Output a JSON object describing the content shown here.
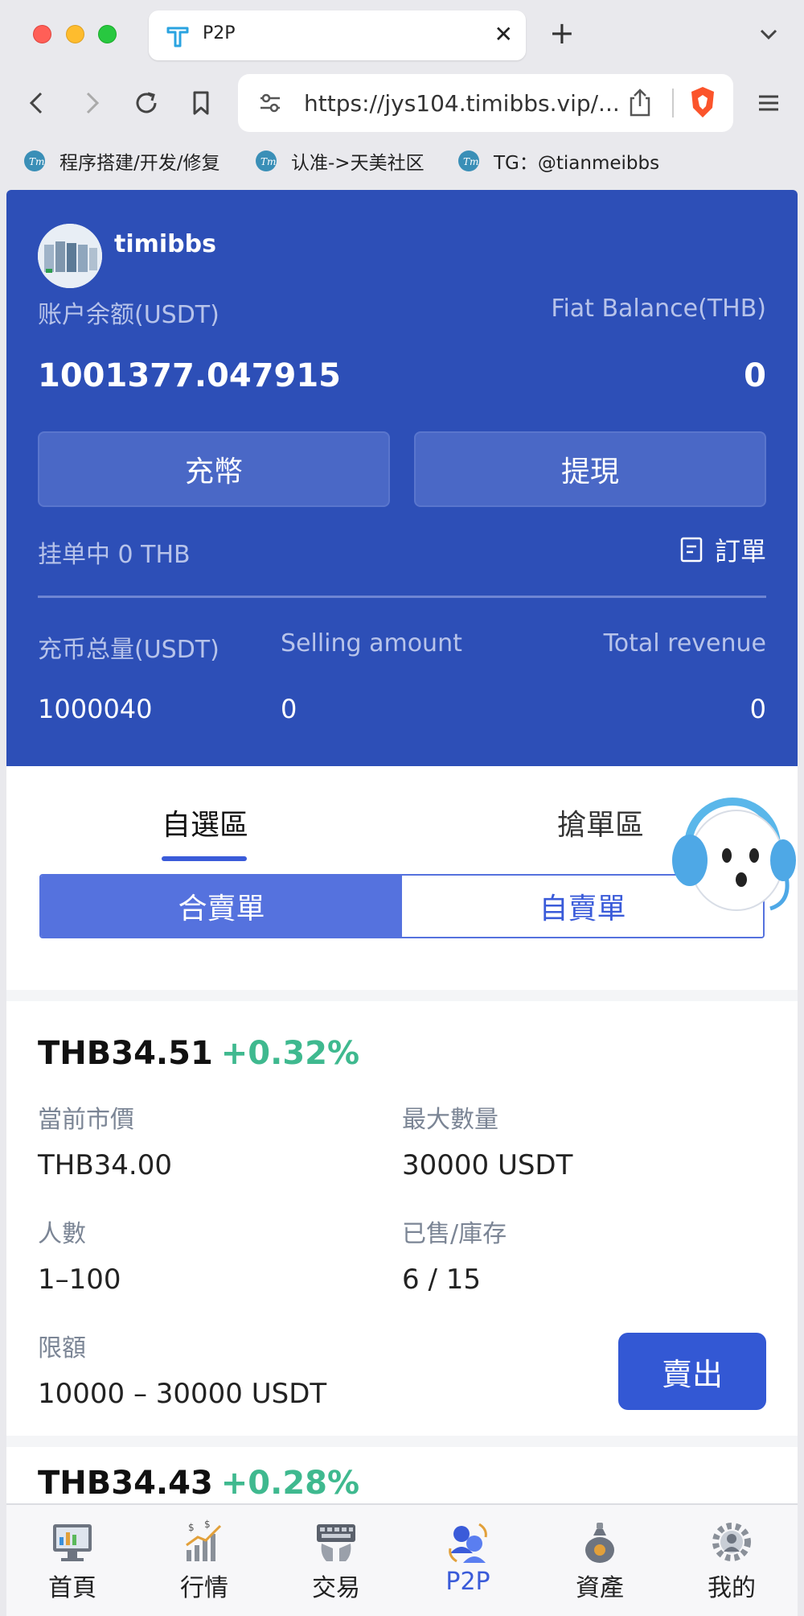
{
  "browser": {
    "tab_title": "P2P",
    "url": "https://jys104.timibbs.vip/...",
    "bookmarks": [
      {
        "label": "程序搭建/开发/修复"
      },
      {
        "label": "认准->天美社区"
      },
      {
        "label": "TG：@tianmeibbs"
      }
    ]
  },
  "account": {
    "username": "timibbs",
    "balance_label": "账户余额(USDT)",
    "fiat_label": "Fiat Balance(THB)",
    "balance_value": "1001377.047915",
    "fiat_value": "0",
    "deposit_label": "充幣",
    "withdraw_label": "提現",
    "pending_label": "挂单中 0 THB",
    "orders_label": "訂單",
    "stats": [
      {
        "label": "充币总量(USDT)",
        "value": "1000040"
      },
      {
        "label": "Selling amount",
        "value": "0"
      },
      {
        "label": "Total revenue",
        "value": "0"
      }
    ]
  },
  "tabs": {
    "primary": [
      {
        "label": "自選區",
        "active": true
      },
      {
        "label": "搶單區",
        "active": false
      }
    ],
    "toggle": [
      {
        "label": "合賣單",
        "active": true
      },
      {
        "label": "自賣單",
        "active": false
      }
    ]
  },
  "listings": [
    {
      "price": "THB34.51",
      "change": "+0.32%",
      "market_price_label": "當前市價",
      "market_price": "THB34.00",
      "max_qty_label": "最大數量",
      "max_qty": "30000 USDT",
      "people_label": "人數",
      "people": "1–100",
      "sold_label": "已售/庫存",
      "sold": "6 / 15",
      "limit_label": "限額",
      "limit": "10000 – 30000 USDT",
      "action_label": "賣出"
    },
    {
      "price": "THB34.43",
      "change": "+0.28%"
    }
  ],
  "bottom_nav": [
    {
      "label": "首頁",
      "icon": "home-dashboard-icon",
      "active": false
    },
    {
      "label": "行情",
      "icon": "market-chart-icon",
      "active": false
    },
    {
      "label": "交易",
      "icon": "trade-keyboard-icon",
      "active": false
    },
    {
      "label": "P2P",
      "icon": "p2p-users-icon",
      "active": true
    },
    {
      "label": "資產",
      "icon": "assets-moneybag-icon",
      "active": false
    },
    {
      "label": "我的",
      "icon": "profile-gear-icon",
      "active": false
    }
  ],
  "colors": {
    "hero_bg": "#2d4fb7",
    "accent": "#3a5bd9",
    "positive": "#3fb98f"
  }
}
